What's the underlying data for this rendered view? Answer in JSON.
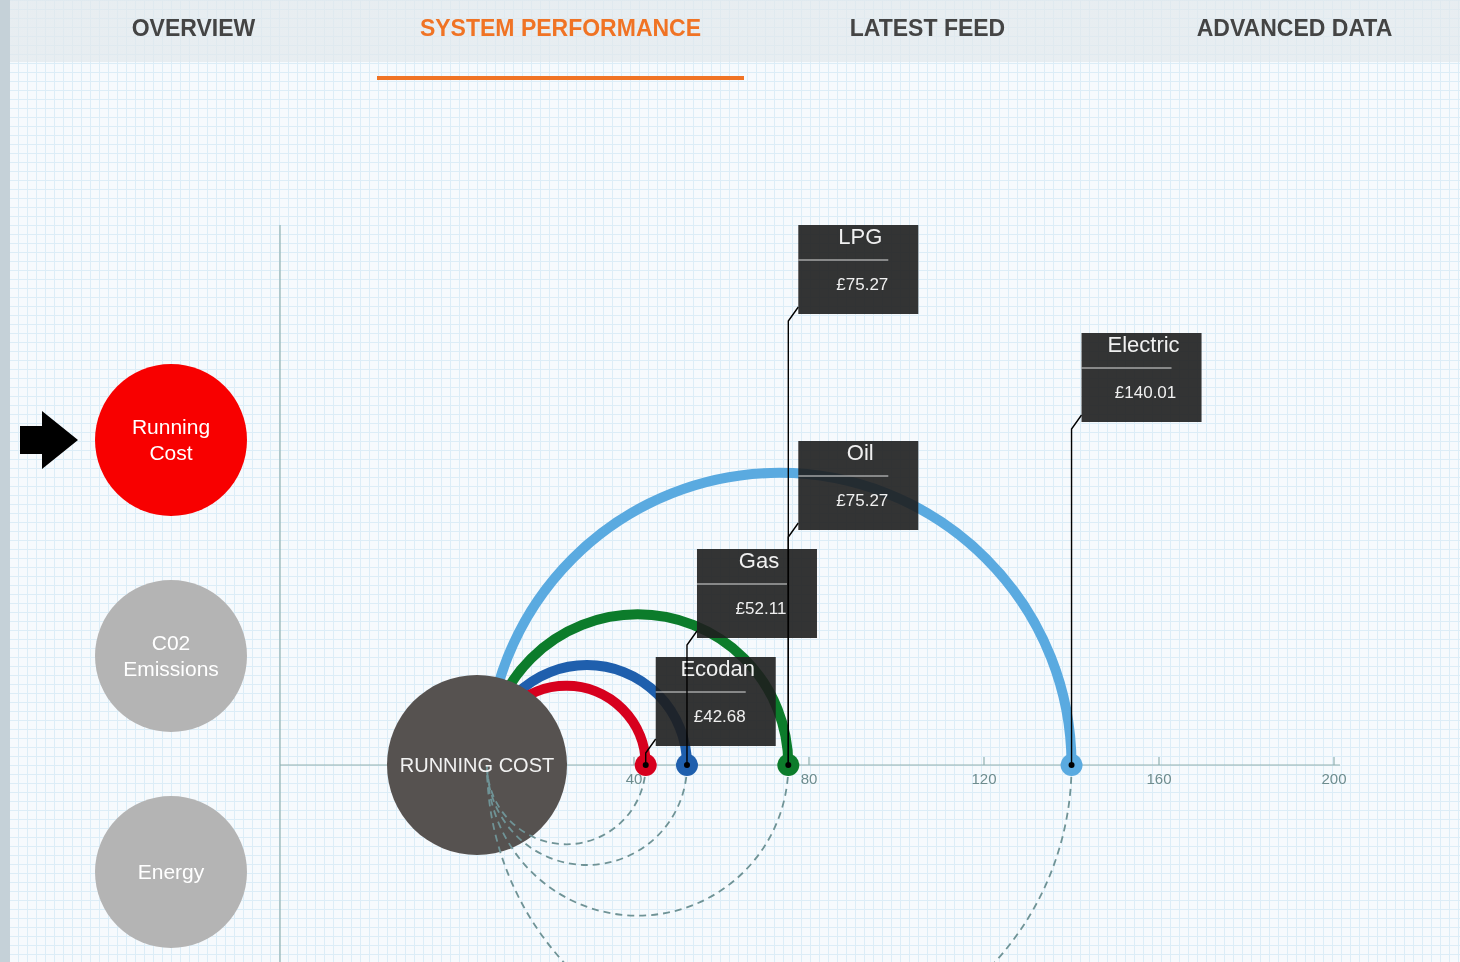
{
  "tabs": [
    {
      "label": "OVERVIEW",
      "selected": false
    },
    {
      "label": "SYSTEM PERFORMANCE",
      "selected": true
    },
    {
      "label": "LATEST FEED",
      "selected": false
    },
    {
      "label": "ADVANCED DATA",
      "selected": false
    }
  ],
  "metrics": [
    {
      "label": "Running Cost",
      "selected": true
    },
    {
      "label": "C02 Emissions",
      "selected": false
    },
    {
      "label": "Energy",
      "selected": false
    }
  ],
  "chart": {
    "center_label": "RUNNING COST",
    "axis_ticks": [
      "40",
      "80",
      "120",
      "160",
      "200"
    ],
    "items": [
      {
        "name": "Ecodan",
        "value": "£42.68",
        "color": "#d7001e"
      },
      {
        "name": "Gas",
        "value": "£52.11",
        "color": "#1f5fad"
      },
      {
        "name": "Oil",
        "value": "£75.27",
        "color": "#0c7c2b"
      },
      {
        "name": "Electric",
        "value": "£140.01",
        "color": "#5aaae0"
      },
      {
        "name": "LPG",
        "value": "£75.27",
        "color": "#0c7c2b"
      }
    ]
  }
}
